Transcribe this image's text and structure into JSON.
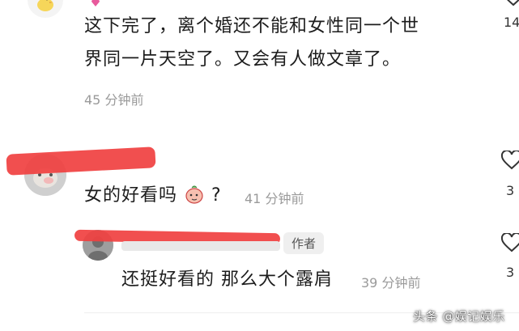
{
  "comments": [
    {
      "text_line1": "这下完了，离个婚还不能和女性同一个世",
      "text_line2": "界同一片天空了。又会有人做文章了。",
      "time": "45 分钟前",
      "like_count": "14"
    },
    {
      "text": "女的好看吗",
      "text_after_emoji": "?",
      "time": "41 分钟前",
      "like_count": "3"
    },
    {
      "reply_text": "还挺好看的 那么大个露肩",
      "time": "39 分钟前",
      "author_badge": "作者",
      "like_count": "3"
    }
  ],
  "watermark": "头条 @娱记娱乐"
}
